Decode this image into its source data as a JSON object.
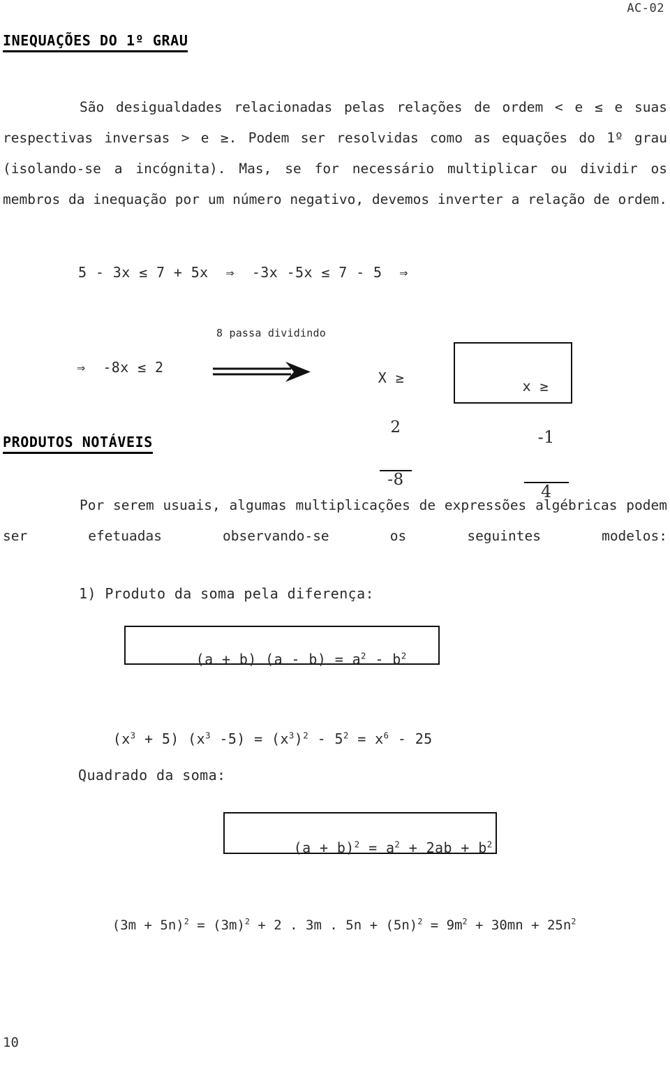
{
  "header": {
    "doc_code": "AC-02"
  },
  "sections": [
    {
      "heading": "INEQUAÇÕES DO 1º GRAU",
      "paragraph": "São desigualdades relacionadas pelas relações de ordem < e ≤ e suas respectivas inversas > e ≥. Podem ser resolvidas como as equações do 1º grau (isolando-se a incógnita). Mas, se for necessário multiplicar ou dividir os membros da inequação por um número negativo, devemos inverter a relação de ordem."
    },
    {
      "heading": "PRODUTOS NOTÁVEIS",
      "paragraph": "Por serem usuais, algumas multiplicações de expressões algébricas podem ser efetuadas observando-se os seguintes modelos:"
    }
  ],
  "worked_example": {
    "line1": "5 - 3x ≤ 7 + 5x  ⇒  -3x -5x ≤ 7 - 5  ⇒",
    "line2": "⇒  -8x ≤ 2",
    "arrow_label": "8 passa dividindo",
    "result_prefix": "X ≥",
    "result_fraction": {
      "numerator": "2",
      "denominator": "-8"
    },
    "boxed_answer": {
      "prefix": "x ≥",
      "fraction": {
        "numerator": "-1",
        "denominator": "4"
      }
    }
  },
  "products": {
    "item1_label": "1) Produto da soma pela diferença:",
    "box1_formula_parts": {
      "left": "(a + b) (a - b) = a",
      "exp1": "2",
      "middle": " - b",
      "exp2": "2"
    },
    "example1_parts": {
      "p1": "(x",
      "e1": "3",
      "p2": " + 5) (x",
      "e2": "3",
      "p3": " -5) = (x",
      "e3": "3",
      "p4": ")",
      "e4": "2",
      "p5": " - 5",
      "e5": "2",
      "p6": " = x",
      "e6": "6",
      "p7": " - 25"
    },
    "item2_label": "Quadrado da soma:",
    "box2_formula_parts": {
      "left": "(a + b)",
      "exp1": "2",
      "mid1": " = a",
      "exp2": "2",
      "mid2": " + 2ab + b",
      "exp3": "2"
    },
    "example2_parts": {
      "p1": "(3m + 5n)",
      "e1": "2",
      "p2": " = (3m)",
      "e2": "2",
      "p3": " + 2 . 3m . 5n + (5n)",
      "e3": "2",
      "p4": " = 9m",
      "e4": "2",
      "p5": " + 30mn + 25n",
      "e5": "2"
    }
  },
  "footer": {
    "page_number": "10"
  },
  "colors": {
    "text": "#2a2a2a",
    "rule": "#111111",
    "background": "#ffffff"
  }
}
